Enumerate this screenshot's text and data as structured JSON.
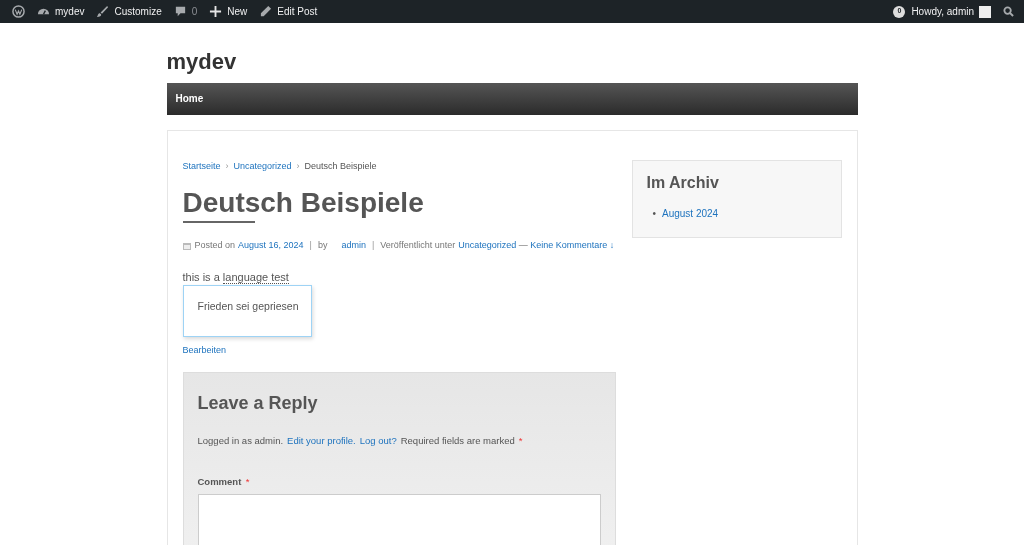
{
  "admin_bar": {
    "left": [
      {
        "kind": "wp"
      },
      {
        "kind": "dashboard",
        "label": "mydev"
      },
      {
        "kind": "brush",
        "label": "Customize"
      },
      {
        "kind": "comment",
        "label": "0"
      },
      {
        "kind": "plus",
        "label": "New"
      },
      {
        "kind": "pencil",
        "label": "Edit Post"
      }
    ],
    "notification": "0",
    "greeting": "Howdy, admin"
  },
  "site_title": "mydev",
  "nav": [
    {
      "label": "Home",
      "selected": true
    }
  ],
  "breadcrumbs": [
    {
      "label": "Startseite",
      "link": true
    },
    {
      "label": "Uncategorized",
      "link": true
    },
    {
      "label": "Deutsch Beispiele",
      "link": false
    }
  ],
  "breadcrumb_separator": "›",
  "post": {
    "title": "Deutsch Beispiele",
    "posted_on": "Posted on",
    "date": "August 16, 2024",
    "separator": "|",
    "by": "by",
    "author": "admin",
    "category_prefix": "Veröffentlicht unter",
    "category": "Uncategorized",
    "dash": "—",
    "comments_link": "Keine Kommentare ↓",
    "body_prefix": "this is a ",
    "body_term": "language test",
    "tooltip": "Frieden sei gepriesen",
    "edit_link": "Bearbeiten"
  },
  "reply": {
    "title": "Leave a Reply",
    "logged_in": "Logged in as admin.",
    "edit_profile": "Edit your profile.",
    "logout": "Log out?",
    "required_note": "Required fields are marked",
    "required_mark": "*",
    "comment_label": "Comment"
  },
  "sidebar": {
    "title": "Im Archiv",
    "bullet": "•",
    "items": [
      "August 2024"
    ]
  }
}
